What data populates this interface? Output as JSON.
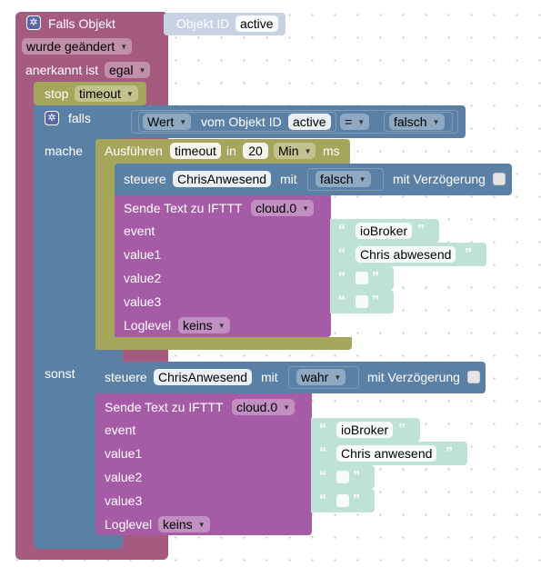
{
  "event_block": {
    "falls_objekt_label": "Falls Objekt",
    "objekt_id_label": "Objekt ID",
    "objekt_id_value": "active",
    "wurde_geaendert": "wurde geändert",
    "anerkannt_label": "anerkannt ist",
    "anerkannt_value": "egal"
  },
  "stop_block": {
    "label": "stop",
    "value": "timeout"
  },
  "if_block": {
    "falls_label": "falls",
    "mache_label": "mache",
    "sonst_label": "sonst",
    "compare": {
      "left_field": "Wert",
      "vom_objekt_label": "vom Objekt ID",
      "object_id": "active",
      "operator": "=",
      "right_value": "falsch"
    }
  },
  "timeout_block": {
    "ausfuehren_label": "Ausführen",
    "name": "timeout",
    "in_label": "in",
    "delay": "20",
    "unit": "Min",
    "ms_label": "ms"
  },
  "steuere_blocks": [
    {
      "label": "steuere",
      "object": "ChrisAnwesend",
      "mit_label": "mit",
      "value": "falsch",
      "delay_label": "mit Verzögerung"
    },
    {
      "label": "steuere",
      "object": "ChrisAnwesend",
      "mit_label": "mit",
      "value": "wahr",
      "delay_label": "mit Verzögerung"
    }
  ],
  "ifttt_blocks": [
    {
      "title": "Sende Text zu IFTTT",
      "instance": "cloud.0",
      "event_label": "event",
      "event_value": "ioBroker",
      "value1_label": "value1",
      "value1_value": "Chris abwesend",
      "value2_label": "value2",
      "value3_label": "value3",
      "loglevel_label": "Loglevel",
      "loglevel_value": "keins"
    },
    {
      "title": "Sende Text zu IFTTT",
      "instance": "cloud.0",
      "event_label": "event",
      "event_value": "ioBroker",
      "value1_label": "value1",
      "value1_value": "Chris anwesend",
      "value2_label": "value2",
      "value3_label": "value3",
      "loglevel_label": "Loglevel",
      "loglevel_value": "keins"
    }
  ],
  "quote_open": "“",
  "quote_close": "”",
  "icons": {
    "gear": "gear-icon",
    "dropdown": "dropdown-arrow-icon"
  },
  "colors": {
    "event_block": "#a55b80",
    "stop_block": "#a5a55b",
    "if_block": "#5b80a5",
    "timeout_block": "#a5a55b",
    "steuere_block": "#5b80a5",
    "ifttt_block": "#a55ba5",
    "text_block": "#bfe2d6",
    "compare_block": "#5b80a5"
  }
}
